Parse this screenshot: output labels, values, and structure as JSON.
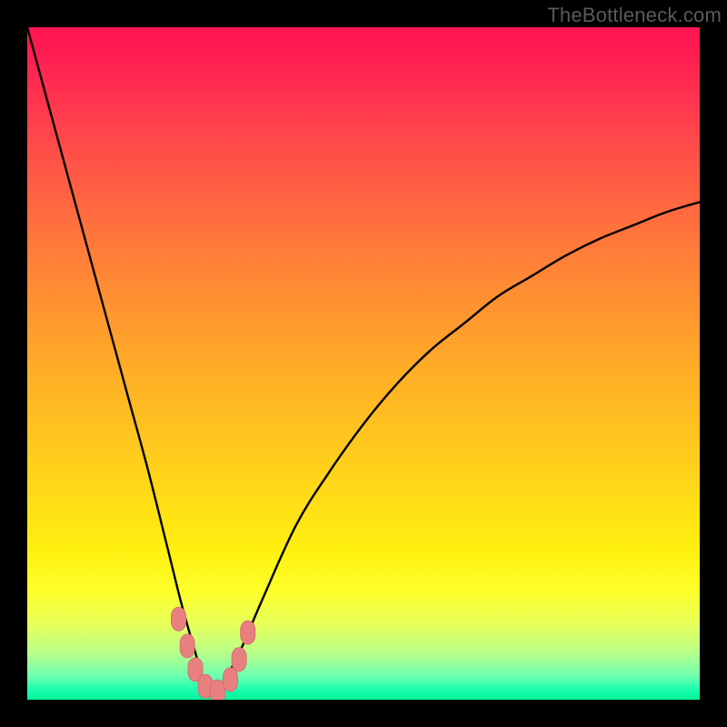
{
  "watermark": {
    "text": "TheBottleneck.com"
  },
  "colors": {
    "frame_bg": "#000000",
    "curve_stroke": "#000000",
    "marker_fill": "#e98080",
    "marker_stroke": "#d66f6f"
  },
  "chart_data": {
    "type": "line",
    "title": "",
    "xlabel": "",
    "ylabel": "",
    "xlim": [
      0,
      100
    ],
    "ylim": [
      0,
      100
    ],
    "grid": false,
    "legend": false,
    "note": "Bottleneck-style V curve; y ≈ 100 at x=0, dips to ≈1 at x≈27, rises toward ≈74 at x=100. Values estimated from pixels.",
    "series": [
      {
        "name": "curve",
        "x": [
          0,
          3,
          6,
          9,
          12,
          15,
          18,
          21,
          23,
          25,
          26,
          27,
          28,
          29,
          30,
          32,
          35,
          40,
          45,
          50,
          55,
          60,
          65,
          70,
          75,
          80,
          85,
          90,
          95,
          100
        ],
        "y": [
          100,
          89,
          78,
          67,
          56,
          45,
          34,
          22,
          14,
          7,
          3.5,
          1,
          1,
          2,
          4,
          8,
          15,
          26,
          34,
          41,
          47,
          52,
          56,
          60,
          63,
          66,
          68.5,
          70.5,
          72.5,
          74
        ]
      }
    ],
    "markers": {
      "note": "Salmon-colored rounded markers near the V bottom",
      "points": [
        {
          "x": 22.5,
          "y": 12
        },
        {
          "x": 23.8,
          "y": 8
        },
        {
          "x": 25.0,
          "y": 4.5
        },
        {
          "x": 26.5,
          "y": 2
        },
        {
          "x": 28.3,
          "y": 1.2
        },
        {
          "x": 30.2,
          "y": 3
        },
        {
          "x": 31.5,
          "y": 6
        },
        {
          "x": 32.8,
          "y": 10
        }
      ]
    }
  }
}
